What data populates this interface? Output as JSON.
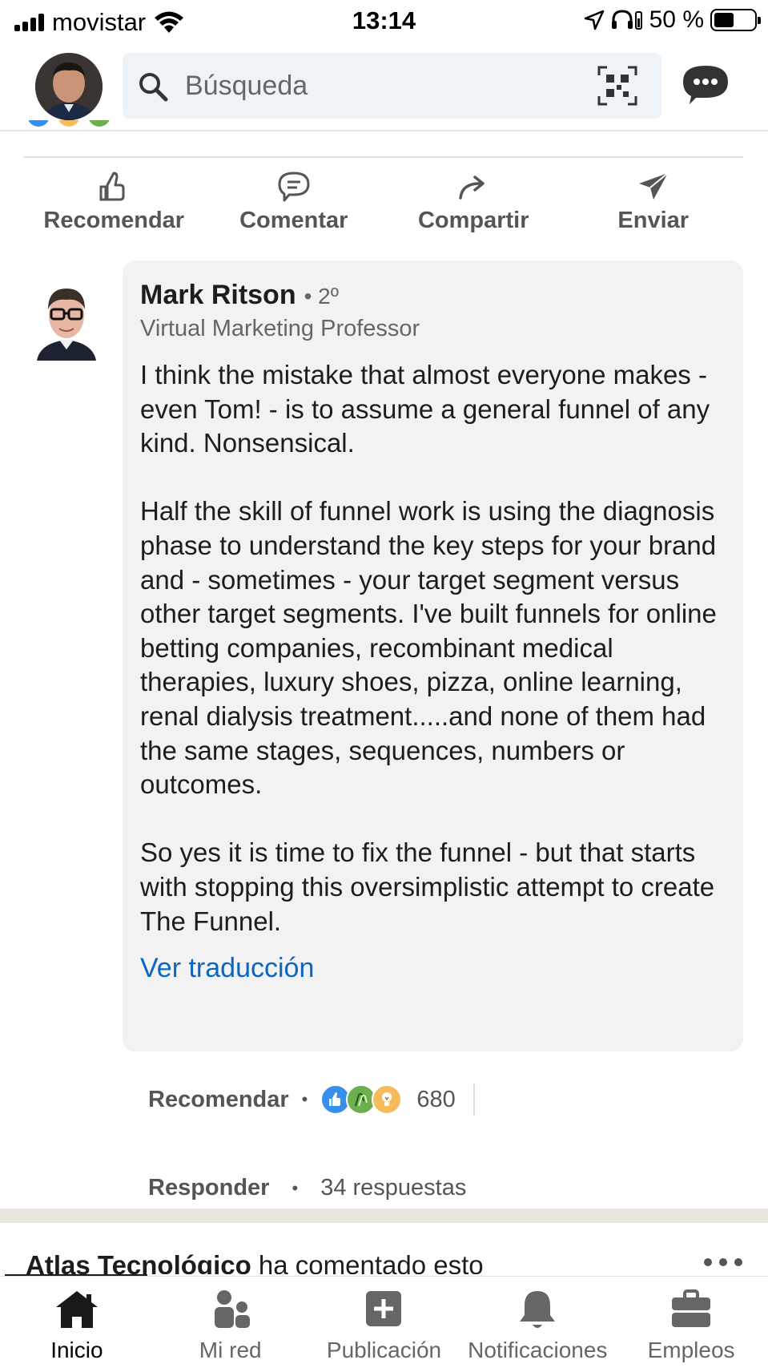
{
  "status_bar": {
    "carrier": "movistar",
    "time": "13:14",
    "battery": "50 %"
  },
  "search": {
    "placeholder": "Búsqueda"
  },
  "actions": {
    "like": "Recomendar",
    "comment": "Comentar",
    "share": "Compartir",
    "send": "Enviar"
  },
  "comment": {
    "author": "Mark Ritson",
    "degree": "• 2º",
    "headline": "Virtual Marketing Professor",
    "body": "I think the mistake that almost everyone makes - even Tom! - is to assume a general funnel of any kind. Nonsensical.\n\nHalf the skill of funnel work is using the diagnosis phase to understand the key steps for your brand and - sometimes - your target segment versus other target segments. I've built funnels for online betting companies, recombinant medical therapies, luxury shoes, pizza, online learning, renal dialysis treatment.....and none of them had the same stages, sequences, numbers or outcomes.\n\nSo yes it is time to fix the funnel - but that starts with stopping this oversimplistic attempt to create The Funnel.",
    "translate": "Ver traducción",
    "like_label": "Recomendar",
    "dot": "•",
    "reactions": [
      "like",
      "celebrate",
      "insightful"
    ],
    "reaction_count": "680",
    "reply_label": "Responder",
    "replies": "34 respuestas"
  },
  "next_post": {
    "actor": "Atlas Tecnológico",
    "text": " ha comentado esto"
  },
  "bottom_nav": {
    "home": "Inicio",
    "network": "Mi red",
    "post": "Publicación",
    "notifications": "Notificaciones",
    "jobs": "Empleos"
  },
  "colors": {
    "link": "#0a66c2",
    "bubble": "#f2f2f2",
    "search_bg": "#eef3f8"
  }
}
